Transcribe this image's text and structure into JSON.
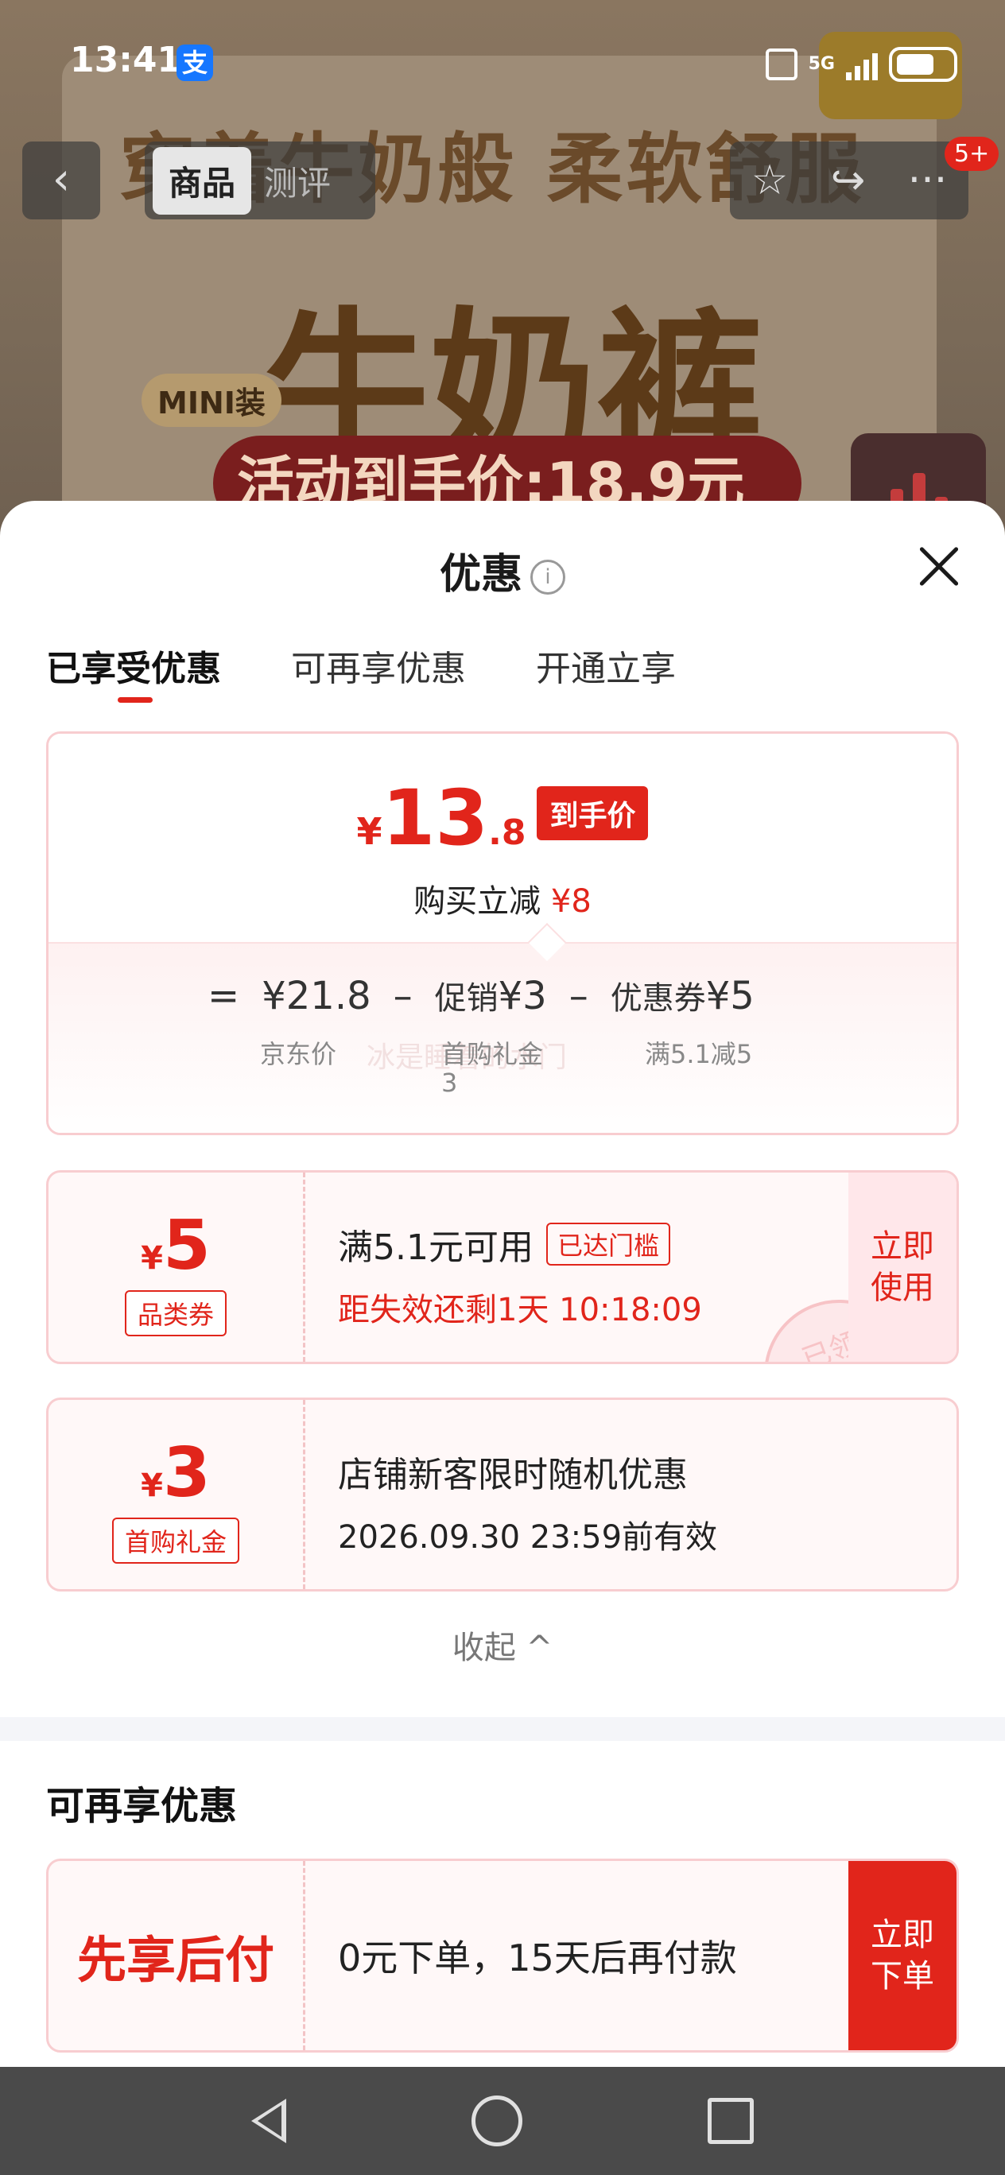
{
  "status_bar": {
    "time": "13:41",
    "alipay_glyph": "支",
    "network": "5G"
  },
  "background": {
    "headline": "穿着牛奶般 柔软舒服",
    "big_text": "牛奶裤",
    "mini_label": "MINI装",
    "promo_text": "活动到手价:18.9元"
  },
  "top_nav": {
    "tabs": [
      "商品",
      "测评"
    ],
    "badge": "5+"
  },
  "sheet": {
    "title": "优惠",
    "tabs": [
      "已享受优惠",
      "可再享优惠",
      "开通立享"
    ],
    "price_card": {
      "currency": "¥",
      "price_int": "13",
      "price_dec": ".8",
      "price_tag": "到手价",
      "save_label": "购买立减",
      "save_amount": "¥8",
      "equals": "=",
      "jd_price": "¥21.8",
      "minus1": "–",
      "promo": "促销",
      "promo_amount": "¥3",
      "minus2": "–",
      "coupon": "优惠券",
      "coupon_amount": "¥5",
      "jd_price_label": "京东价",
      "promo_sub": "首购礼金",
      "promo_sub2": "3",
      "coupon_sub": "满5.1减5",
      "faint_text": "冰是睡着的水门"
    },
    "coupons": [
      {
        "currency": "¥",
        "amount": "5",
        "type": "品类券",
        "condition": "满5.1元可用",
        "reached_tag": "已达门槛",
        "expiry": "距失效还剩1天 10:18:09",
        "action": "立即\n使用",
        "stamp": "已领"
      },
      {
        "currency": "¥",
        "amount": "3",
        "type": "首购礼金",
        "condition": "店铺新客限时随机优惠",
        "expiry": "2026.09.30 23:59前有效"
      }
    ],
    "collapse_label": "收起 ^",
    "more_section_title": "可再享优惠",
    "bnpl": {
      "label": "先享后付",
      "text": "0元下单，15天后再付款",
      "action": "立即\n下单"
    }
  },
  "colors": {
    "brand_red": "#e1251b",
    "sheet_bg": "#ffffff",
    "nav_bar": "#4a4a4a"
  }
}
